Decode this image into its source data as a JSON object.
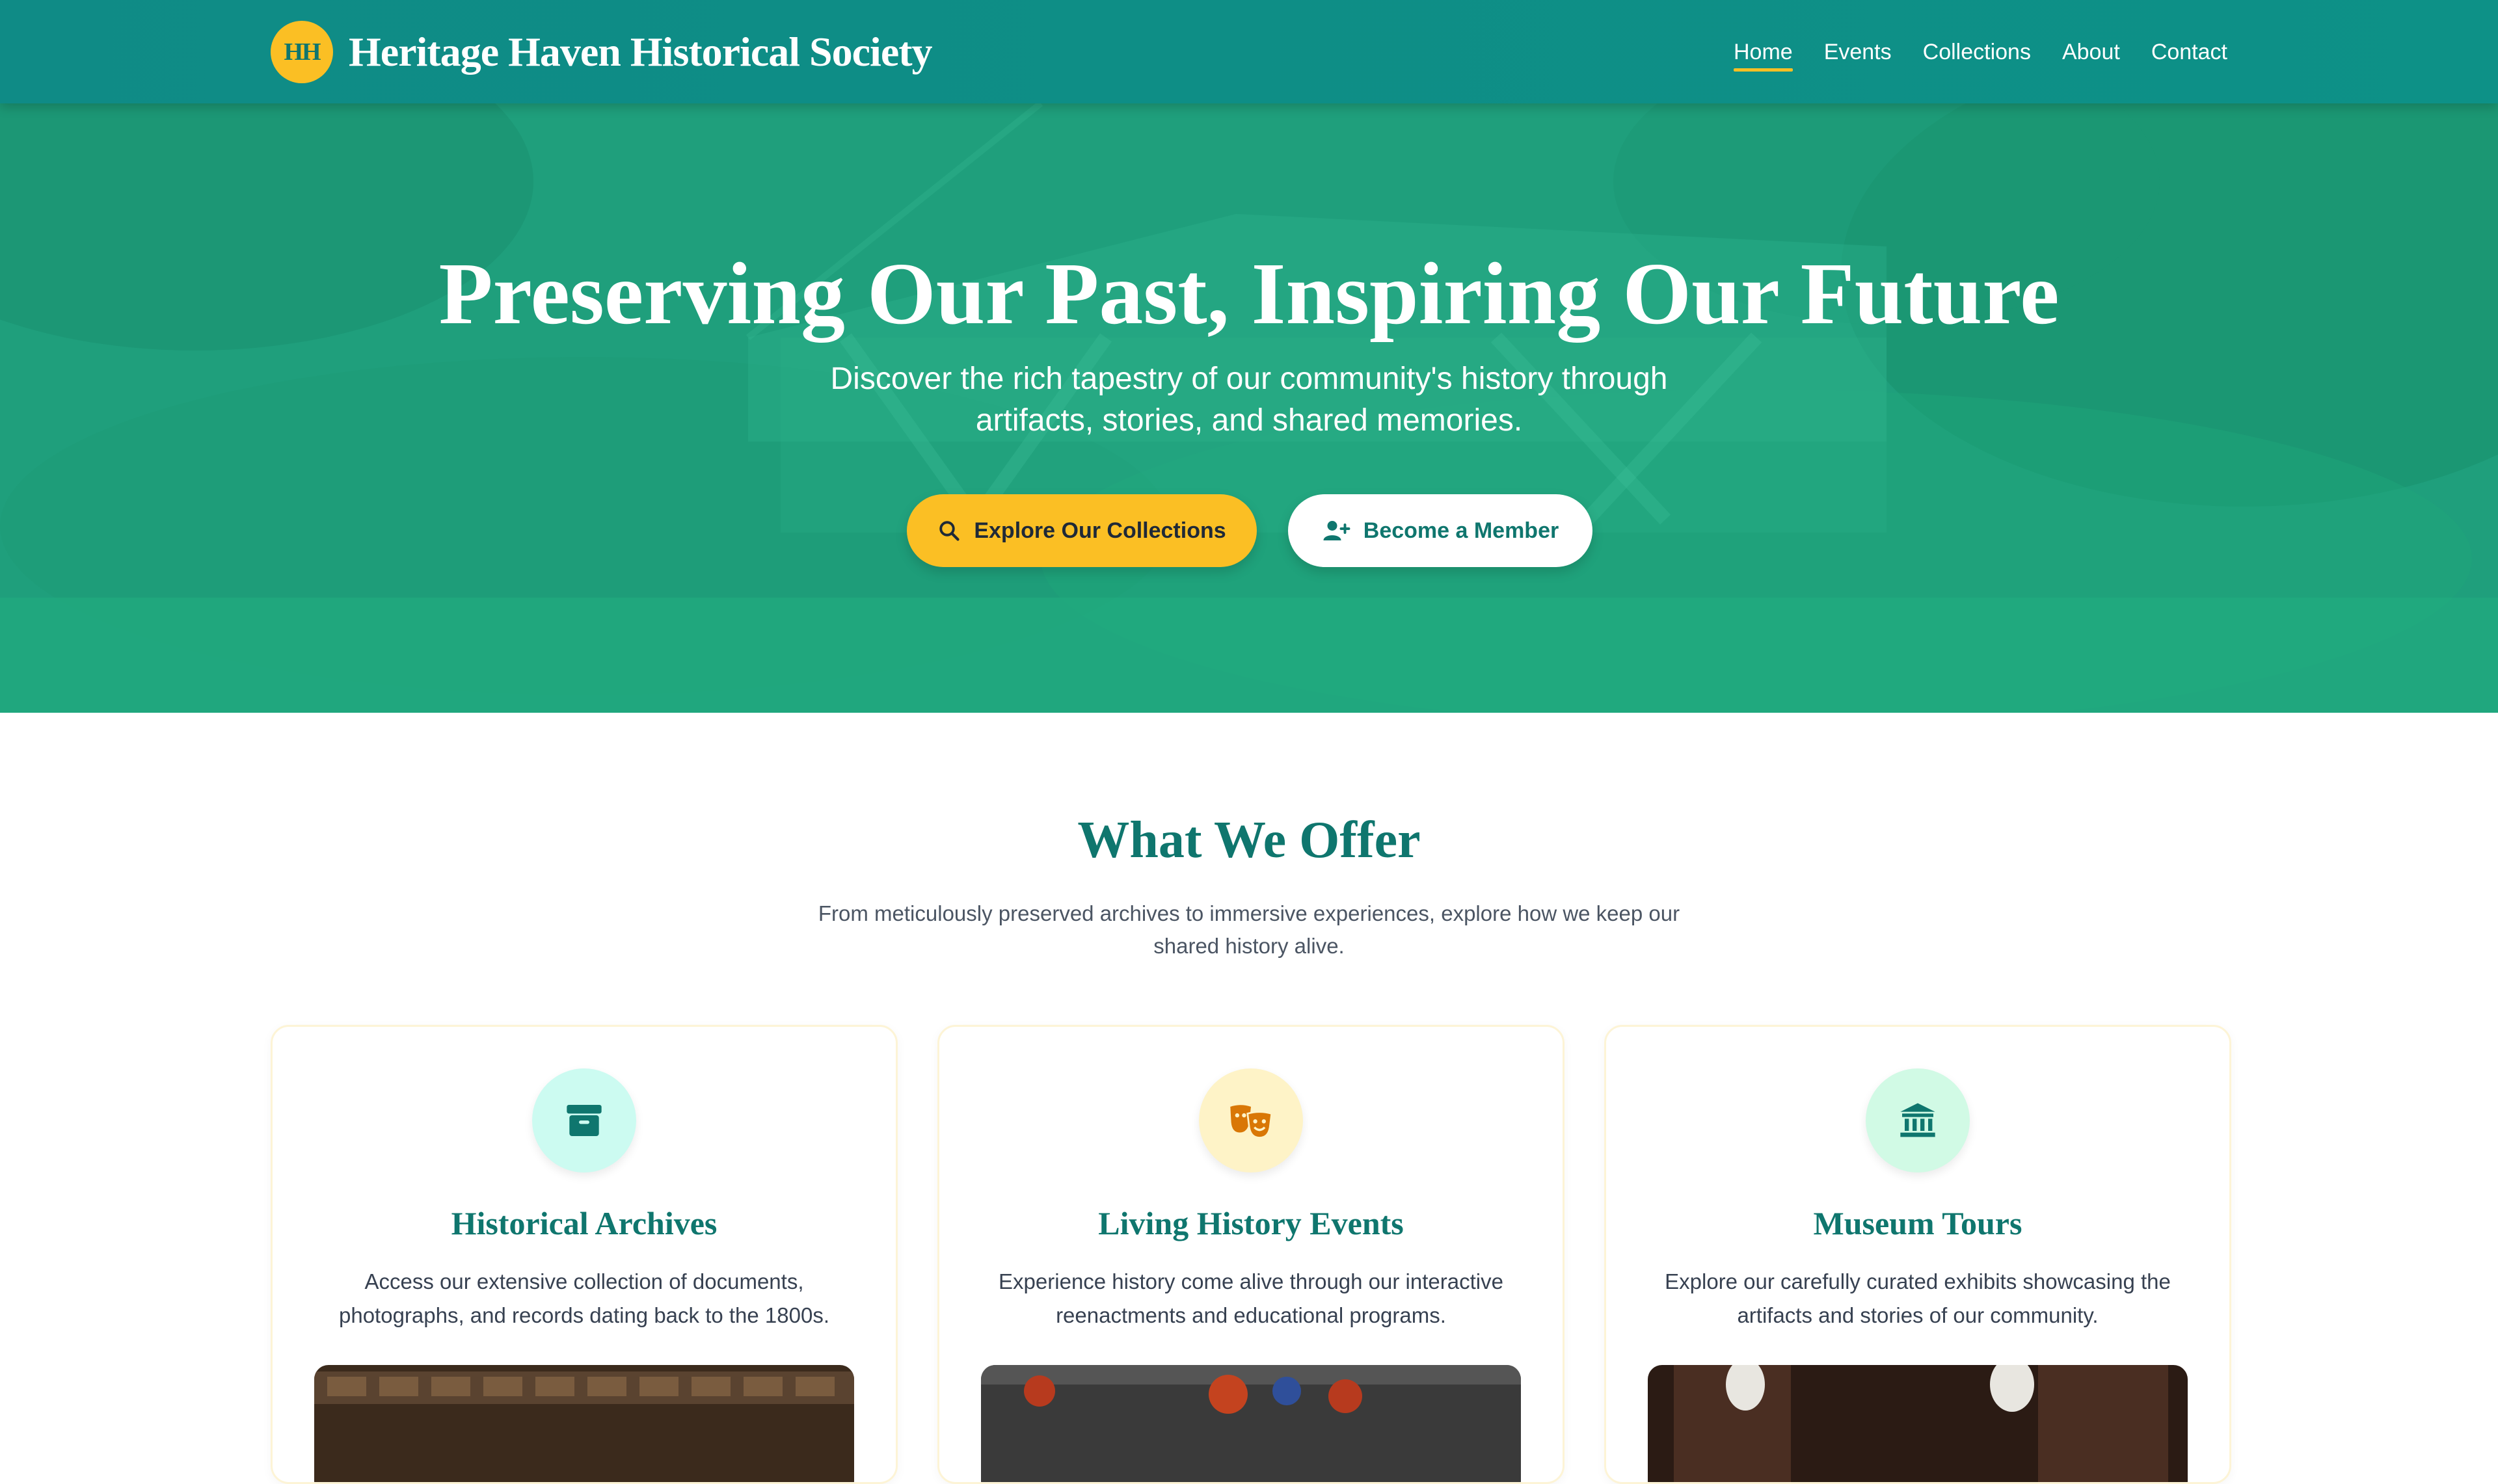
{
  "nav": {
    "logo_text": "HH",
    "brand": "Heritage Haven Historical Society",
    "links": [
      {
        "label": "Home",
        "active": true
      },
      {
        "label": "Events",
        "active": false
      },
      {
        "label": "Collections",
        "active": false
      },
      {
        "label": "About",
        "active": false
      },
      {
        "label": "Contact",
        "active": false
      }
    ]
  },
  "hero": {
    "title": "Preserving Our Past, Inspiring Our Future",
    "subtitle": "Discover the rich tapestry of our community's history through artifacts, stories, and shared memories.",
    "primary_button": {
      "label": "Explore Our Collections",
      "icon": "search-icon"
    },
    "secondary_button": {
      "label": "Become a Member",
      "icon": "user-plus-icon"
    }
  },
  "offer": {
    "title": "What We Offer",
    "subtitle": "From meticulously preserved archives to immersive experiences, explore how we keep our shared history alive.",
    "cards": [
      {
        "title": "Historical Archives",
        "text": "Access our extensive collection of documents, photographs, and records dating back to the 1800s.",
        "icon": "archive-box-icon",
        "icon_bg": "#ccfbf1",
        "icon_color": "#0f766e"
      },
      {
        "title": "Living History Events",
        "text": "Experience history come alive through our interactive reenactments and educational programs.",
        "icon": "theater-masks-icon",
        "icon_bg": "#fef3c7",
        "icon_color": "#d97706"
      },
      {
        "title": "Museum Tours",
        "text": "Explore our carefully curated exhibits showcasing the artifacts and stories of our community.",
        "icon": "museum-building-icon",
        "icon_bg": "#d1fae5",
        "icon_color": "#0f766e"
      }
    ]
  },
  "colors": {
    "primary": "#0f766e",
    "accent": "#fbbf24",
    "hero": "#21a67d"
  }
}
